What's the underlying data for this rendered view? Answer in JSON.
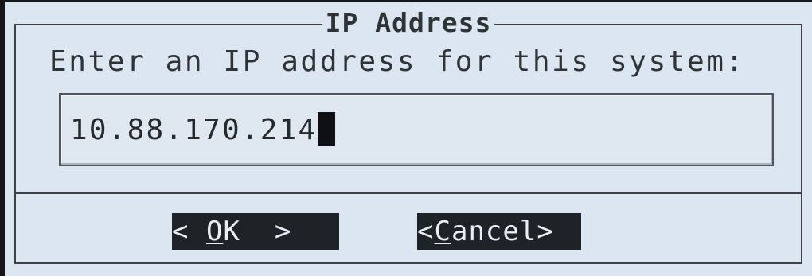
{
  "dialog": {
    "title": "IP Address",
    "prompt": "Enter an IP address for this system:",
    "input": {
      "value": "10.88.170.214"
    },
    "buttons": {
      "ok": {
        "left": "< ",
        "hotkey": "O",
        "rest": "K  >"
      },
      "cancel": {
        "left": "<",
        "hotkey": "C",
        "rest": "ancel>"
      }
    }
  }
}
